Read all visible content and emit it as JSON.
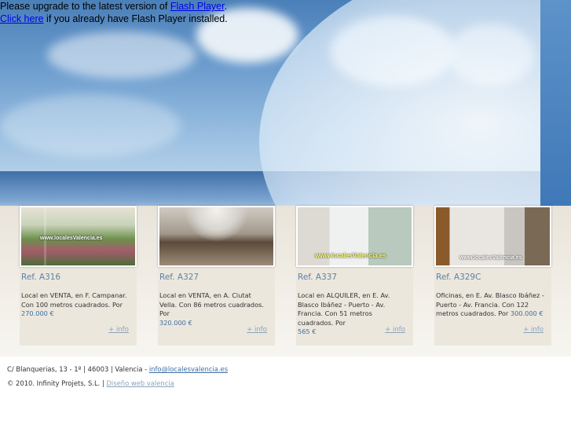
{
  "flash_notice": {
    "line1_prefix": "Please upgrade to the latest version of ",
    "line1_link": "Flash Player",
    "line1_suffix": ".",
    "line2_link": "Click here",
    "line2_suffix": " if you already have Flash Player installed."
  },
  "listings": [
    {
      "ref": "Ref. A316",
      "desc": "Local en VENTA, en F. Campanar. Con 100 metros cuadrados. Por",
      "price": "270.000 €",
      "info": "+ info",
      "watermark": "www.localesValencia.es",
      "thumb_icon": "flower-shop-photo"
    },
    {
      "ref": "Ref. A327",
      "desc": "Local en VENTA, en A. Ciutat Vella. Con 86 metros cuadrados. Por",
      "price": "320.000 €",
      "info": "+ info",
      "watermark": "",
      "thumb_icon": "empty-room-photo"
    },
    {
      "ref": "Ref. A337",
      "desc": "Local en ALQUILER, en E. Av. Blasco Ibáñez - Puerto - Av. Francia. Con 51 metros cuadrados. Por",
      "price": "565 €",
      "info": "+ info",
      "watermark": "www.localesValencia.es",
      "thumb_icon": "storefront-photo"
    },
    {
      "ref": "Ref. A329C",
      "desc": "Oficinas, en E. Av. Blasco Ibáñez - Puerto - Av. Francia. Con 122 metros cuadrados. Por",
      "price": "300.000 €",
      "info": "+ info",
      "watermark": "www.localesValencia.es",
      "thumb_icon": "office-photo"
    }
  ],
  "footer": {
    "address": "C/ Blanquerias, 13 - 1º | 46003 | Valencia - ",
    "email": "info@localesvalencia.es",
    "copyright": "© 2010. Infinity Projets, S.L. | ",
    "credit_link": "Diseño web valencia"
  },
  "colors": {
    "link_blue": "#3d6fa3",
    "ref_blue": "#5f82a6",
    "card_bg": "#ece7dd"
  }
}
